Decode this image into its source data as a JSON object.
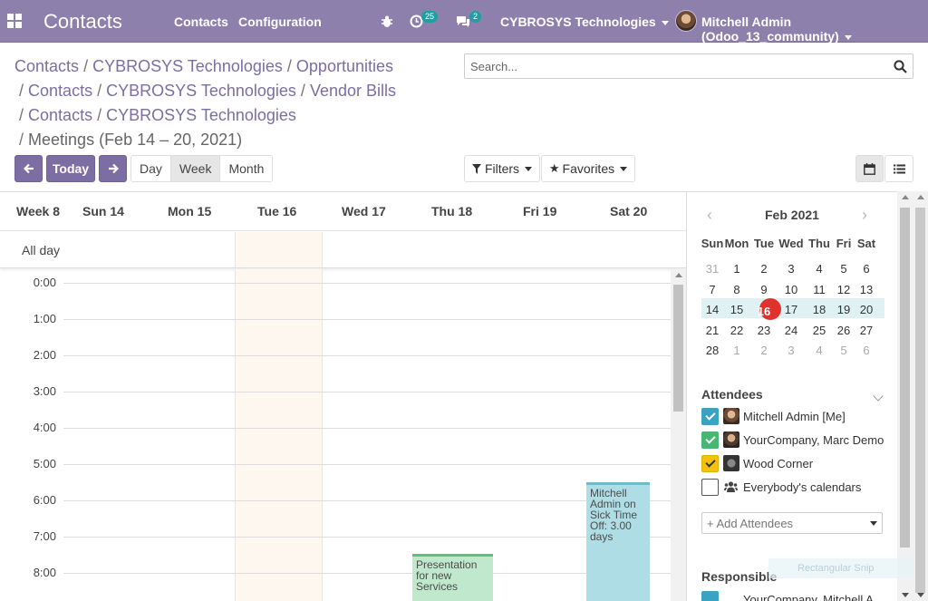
{
  "navbar": {
    "brand": "Contacts",
    "menu": [
      "Contacts",
      "Configuration"
    ],
    "activity_count": "25",
    "messages_count": "2",
    "company": "CYBROSYS Technologies",
    "user": "Mitchell Admin (Odoo_13_community)"
  },
  "breadcrumbs": {
    "line1": [
      "Contacts",
      "CYBROSYS Technologies",
      "Opportunities"
    ],
    "line2": [
      "Contacts",
      "CYBROSYS Technologies",
      "Vendor Bills"
    ],
    "line3": [
      "Contacts",
      "CYBROSYS Technologies"
    ],
    "current": "Meetings (Feb 14 – 20, 2021)"
  },
  "search": {
    "placeholder": "Search..."
  },
  "controls": {
    "today": "Today",
    "scales": [
      "Day",
      "Week",
      "Month"
    ],
    "active_scale": "Week",
    "filters": "Filters",
    "favorites": "Favorites"
  },
  "calendar": {
    "week_label": "Week 8",
    "days": [
      "Sun 14",
      "Mon 15",
      "Tue 16",
      "Wed 17",
      "Thu 18",
      "Fri 19",
      "Sat 20"
    ],
    "all_day": "All day",
    "hours": [
      "0:00",
      "1:00",
      "2:00",
      "3:00",
      "4:00",
      "5:00",
      "6:00",
      "7:00",
      "8:00"
    ],
    "events": [
      {
        "title": "Mitchell Admin on Sick Time Off: 3.00 days",
        "day": "Sat 20",
        "color": "#afdde6",
        "border": "#6cbccc"
      },
      {
        "title": "Presentation for new Services",
        "day": "Thu 18",
        "color": "#bfe8cc",
        "border": "#5fbf7f"
      }
    ]
  },
  "mini_calendar": {
    "title": "Feb 2021",
    "dow": [
      "Sun",
      "Mon",
      "Tue",
      "Wed",
      "Thu",
      "Fri",
      "Sat"
    ],
    "weeks": [
      [
        "31",
        "1",
        "2",
        "3",
        "4",
        "5",
        "6"
      ],
      [
        "7",
        "8",
        "9",
        "10",
        "11",
        "12",
        "13"
      ],
      [
        "14",
        "15",
        "16",
        "17",
        "18",
        "19",
        "20"
      ],
      [
        "21",
        "22",
        "23",
        "24",
        "25",
        "26",
        "27"
      ],
      [
        "28",
        "1",
        "2",
        "3",
        "4",
        "5",
        "6"
      ]
    ],
    "today": "16"
  },
  "attendees": {
    "title": "Attendees",
    "items": [
      {
        "label": "Mitchell Admin [Me]",
        "color": "#3aa3c4"
      },
      {
        "label": "YourCompany, Marc Demo",
        "color": "#46b873"
      },
      {
        "label": "Wood Corner",
        "color": "#f4c20d"
      },
      {
        "label": "Everybody's calendars",
        "color": "#ffffff"
      }
    ],
    "add_placeholder": "+ Add Attendees"
  },
  "responsible": {
    "title": "Responsible",
    "first_item": "YourCompany, Mitchell A..."
  },
  "overlay": {
    "snip_label": "Rectangular Snip"
  }
}
